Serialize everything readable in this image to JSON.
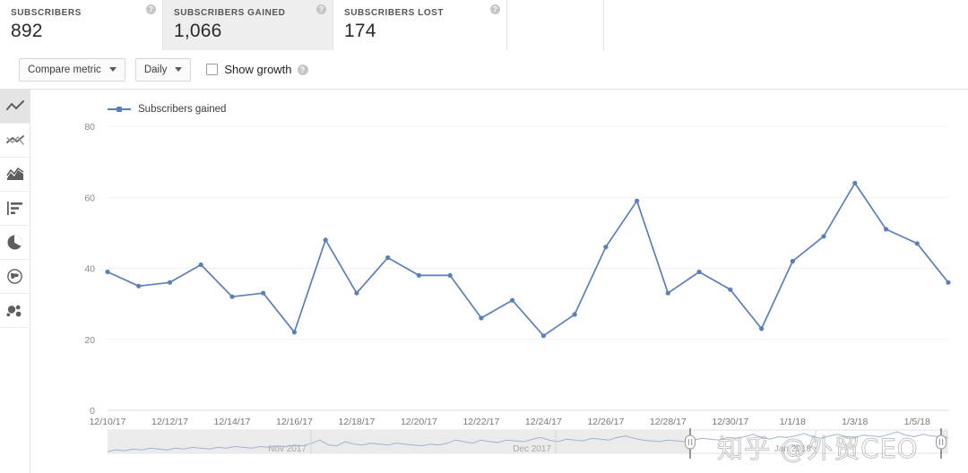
{
  "metrics": [
    {
      "label": "SUBSCRIBERS",
      "value": "892",
      "help": "help-icon",
      "selected": false
    },
    {
      "label": "SUBSCRIBERS GAINED",
      "value": "1,066",
      "help": "help-icon",
      "selected": true
    },
    {
      "label": "SUBSCRIBERS LOST",
      "value": "174",
      "help": "help-icon",
      "selected": false
    },
    {
      "label": "",
      "value": "",
      "help": "",
      "selected": false
    },
    {
      "label": "",
      "value": "",
      "help": "",
      "selected": false
    }
  ],
  "toolbar": {
    "compare_metric_label": "Compare metric",
    "interval_label": "Daily",
    "show_growth_label": "Show growth",
    "show_growth_checked": false,
    "help_glyph": "?"
  },
  "sidebar": {
    "items": [
      {
        "name": "line-chart-icon",
        "active": true
      },
      {
        "name": "compare-lines-icon",
        "active": false
      },
      {
        "name": "area-chart-icon",
        "active": false
      },
      {
        "name": "bar-chart-icon",
        "active": false
      },
      {
        "name": "pie-chart-icon",
        "active": false
      },
      {
        "name": "geography-globe-icon",
        "active": false
      },
      {
        "name": "bubble-chart-icon",
        "active": false
      }
    ]
  },
  "chart_data": {
    "type": "line",
    "title": "",
    "xlabel": "",
    "ylabel": "",
    "ylim": [
      0,
      80
    ],
    "yticks": [
      0,
      20,
      40,
      60,
      80
    ],
    "grid": true,
    "legend_position": "top-left",
    "series": [
      {
        "name": "Subscribers gained",
        "color": "#5b7fb9",
        "values": [
          39,
          35,
          36,
          41,
          32,
          33,
          22,
          48,
          33,
          43,
          38,
          38,
          26,
          31,
          21,
          27,
          46,
          59,
          33,
          39,
          34,
          23,
          42,
          49,
          64,
          51,
          47,
          36
        ]
      }
    ],
    "x": [
      "12/10/17",
      "12/11/17",
      "12/12/17",
      "12/13/17",
      "12/14/17",
      "12/15/17",
      "12/16/17",
      "12/17/17",
      "12/18/17",
      "12/19/17",
      "12/20/17",
      "12/21/17",
      "12/22/17",
      "12/23/17",
      "12/24/17",
      "12/25/17",
      "12/26/17",
      "12/27/17",
      "12/28/17",
      "12/29/17",
      "12/30/17",
      "12/31/17",
      "1/1/18",
      "1/2/18",
      "1/3/18",
      "1/4/18",
      "1/5/18",
      "1/6/18"
    ],
    "xticklabels": [
      "12/10/17",
      "12/12/17",
      "12/14/17",
      "12/16/17",
      "12/18/17",
      "12/20/17",
      "12/22/17",
      "12/24/17",
      "12/26/17",
      "12/28/17",
      "12/30/17",
      "1/1/18",
      "1/3/18",
      "1/5/18"
    ]
  },
  "scrubber": {
    "month_labels": [
      "Nov 2017",
      "Dec 2017",
      "Jan 2018"
    ],
    "left_handle_name": "range-handle-left",
    "right_handle_name": "range-handle-right",
    "overview_values": [
      12,
      14,
      13,
      15,
      14,
      16,
      15,
      14,
      16,
      15,
      17,
      16,
      15,
      17,
      16,
      18,
      17,
      16,
      18,
      17,
      19,
      18,
      20,
      19,
      22,
      26,
      20,
      19,
      24,
      21,
      20,
      22,
      21,
      20,
      22,
      21,
      20,
      19,
      21,
      20,
      22,
      26,
      24,
      22,
      26,
      24,
      23,
      26,
      25,
      24,
      27,
      29,
      26,
      24,
      27,
      26,
      25,
      28,
      27,
      26,
      29,
      31,
      28,
      26,
      25,
      24,
      26,
      25,
      24,
      26,
      28,
      27,
      26,
      29,
      28,
      30,
      33,
      29,
      27,
      30,
      29,
      31,
      34,
      30,
      28,
      31,
      33,
      30,
      29,
      32,
      31,
      30,
      33,
      36,
      32,
      30,
      33,
      31,
      30,
      29
    ]
  },
  "watermark": {
    "text": "知乎 @外贸CEO"
  }
}
